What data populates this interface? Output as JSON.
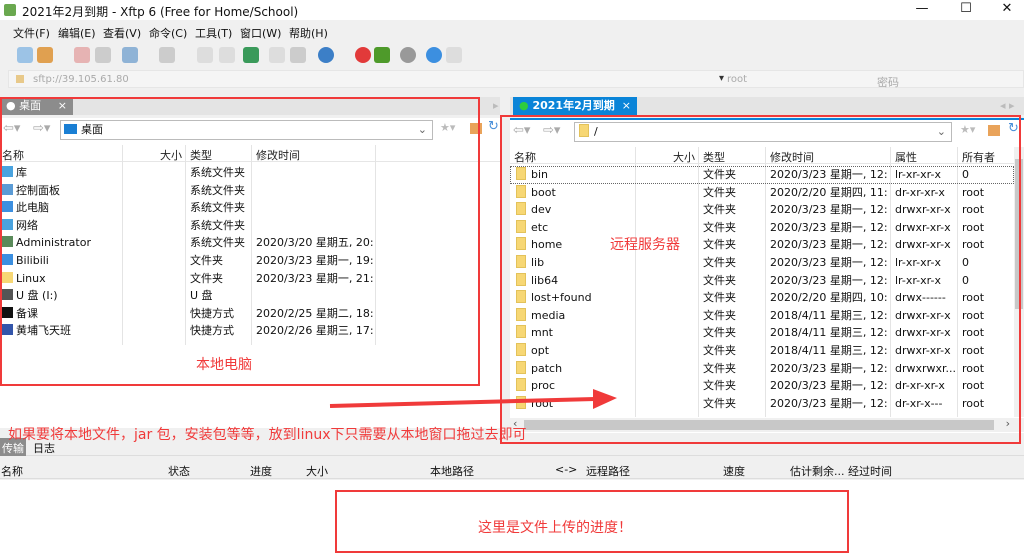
{
  "window": {
    "title": "2021年2月到期 - Xftp 6 (Free for Home/School)",
    "controls": [
      "—",
      "☐",
      "✕"
    ]
  },
  "menu": [
    "文件(F)",
    "编辑(E)",
    "查看(V)",
    "命令(C)",
    "工具(T)",
    "窗口(W)",
    "帮助(H)"
  ],
  "toolbar": [
    "new-session-icon",
    "open-folder-icon",
    "disconnect-icon",
    "reconnect-icon",
    "new-tab-icon",
    "terminal-icon",
    "copy-icon",
    "paste-icon",
    "sync-icon",
    "doc-icon",
    "doc2-icon",
    "globe-icon",
    "xshell-icon",
    "xftp-icon",
    "settings-icon",
    "help-icon",
    "chat-icon"
  ],
  "address": {
    "url": "sftp://39.105.61.80",
    "user": "root",
    "password_placeholder": "密码"
  },
  "local": {
    "tab": "桌面",
    "path": "桌面",
    "columns": [
      "名称",
      "大小",
      "类型",
      "修改时间"
    ],
    "rows": [
      {
        "name": "库",
        "type": "系统文件夹",
        "mtime": ""
      },
      {
        "name": "控制面板",
        "type": "系统文件夹",
        "mtime": ""
      },
      {
        "name": "此电脑",
        "type": "系统文件夹",
        "mtime": ""
      },
      {
        "name": "网络",
        "type": "系统文件夹",
        "mtime": ""
      },
      {
        "name": "Administrator",
        "type": "系统文件夹",
        "mtime": "2020/3/20 星期五, 20:..."
      },
      {
        "name": "Bilibili",
        "type": "文件夹",
        "mtime": "2020/3/23 星期一, 19:..."
      },
      {
        "name": "Linux",
        "type": "文件夹",
        "mtime": "2020/3/23 星期一, 21:..."
      },
      {
        "name": "U 盘 (I:)",
        "type": "U 盘",
        "mtime": ""
      },
      {
        "name": "备课",
        "type": "快捷方式",
        "mtime": "2020/2/25 星期二, 18:..."
      },
      {
        "name": "黄埔飞天班",
        "type": "快捷方式",
        "mtime": "2020/2/26 星期三, 17:..."
      }
    ]
  },
  "remote": {
    "tab": "2021年2月到期",
    "path": "/",
    "columns": [
      "名称",
      "大小",
      "类型",
      "修改时间",
      "属性",
      "所有者"
    ],
    "rows": [
      {
        "name": "bin",
        "type": "文件夹",
        "mtime": "2020/3/23 星期一, 12:...",
        "attr": "lr-xr-xr-x",
        "owner": "0"
      },
      {
        "name": "boot",
        "type": "文件夹",
        "mtime": "2020/2/20 星期四, 11:...",
        "attr": "dr-xr-xr-x",
        "owner": "root"
      },
      {
        "name": "dev",
        "type": "文件夹",
        "mtime": "2020/3/23 星期一, 12:...",
        "attr": "drwxr-xr-x",
        "owner": "root"
      },
      {
        "name": "etc",
        "type": "文件夹",
        "mtime": "2020/3/23 星期一, 12:...",
        "attr": "drwxr-xr-x",
        "owner": "root"
      },
      {
        "name": "home",
        "type": "文件夹",
        "mtime": "2020/3/23 星期一, 12:...",
        "attr": "drwxr-xr-x",
        "owner": "root"
      },
      {
        "name": "lib",
        "type": "文件夹",
        "mtime": "2020/3/23 星期一, 12:...",
        "attr": "lr-xr-xr-x",
        "owner": "0"
      },
      {
        "name": "lib64",
        "type": "文件夹",
        "mtime": "2020/3/23 星期一, 12:...",
        "attr": "lr-xr-xr-x",
        "owner": "0"
      },
      {
        "name": "lost+found",
        "type": "文件夹",
        "mtime": "2020/2/20 星期四, 10:...",
        "attr": "drwx------",
        "owner": "root"
      },
      {
        "name": "media",
        "type": "文件夹",
        "mtime": "2018/4/11 星期三, 12:...",
        "attr": "drwxr-xr-x",
        "owner": "root"
      },
      {
        "name": "mnt",
        "type": "文件夹",
        "mtime": "2018/4/11 星期三, 12:...",
        "attr": "drwxr-xr-x",
        "owner": "root"
      },
      {
        "name": "opt",
        "type": "文件夹",
        "mtime": "2018/4/11 星期三, 12:...",
        "attr": "drwxr-xr-x",
        "owner": "root"
      },
      {
        "name": "patch",
        "type": "文件夹",
        "mtime": "2020/3/23 星期一, 12:...",
        "attr": "drwxrwxr...",
        "owner": "root"
      },
      {
        "name": "proc",
        "type": "文件夹",
        "mtime": "2020/3/23 星期一, 12:...",
        "attr": "dr-xr-xr-x",
        "owner": "root"
      },
      {
        "name": "root",
        "type": "文件夹",
        "mtime": "2020/3/23 星期一, 12:...",
        "attr": "dr-xr-x---",
        "owner": "root"
      }
    ]
  },
  "bottom": {
    "tabs": [
      "传输",
      "日志"
    ],
    "columns": [
      "名称",
      "状态",
      "进度",
      "大小",
      "本地路径",
      "<->",
      "远程路径",
      "速度",
      "估计剩余...",
      "经过时间"
    ]
  },
  "annotations": {
    "local": "本地电脑",
    "remote": "远程服务器",
    "instruction": "如果要将本地文件，jar 包，安装包等等，放到linux下只需要从本地窗口拖过去即可",
    "progress": "这里是文件上传的进度！"
  },
  "colors": {
    "accent": "#0a84d8",
    "annotation": "#f03a3a",
    "active_tab": "#0a84d8",
    "inactive_tab": "#8c8c8c"
  }
}
